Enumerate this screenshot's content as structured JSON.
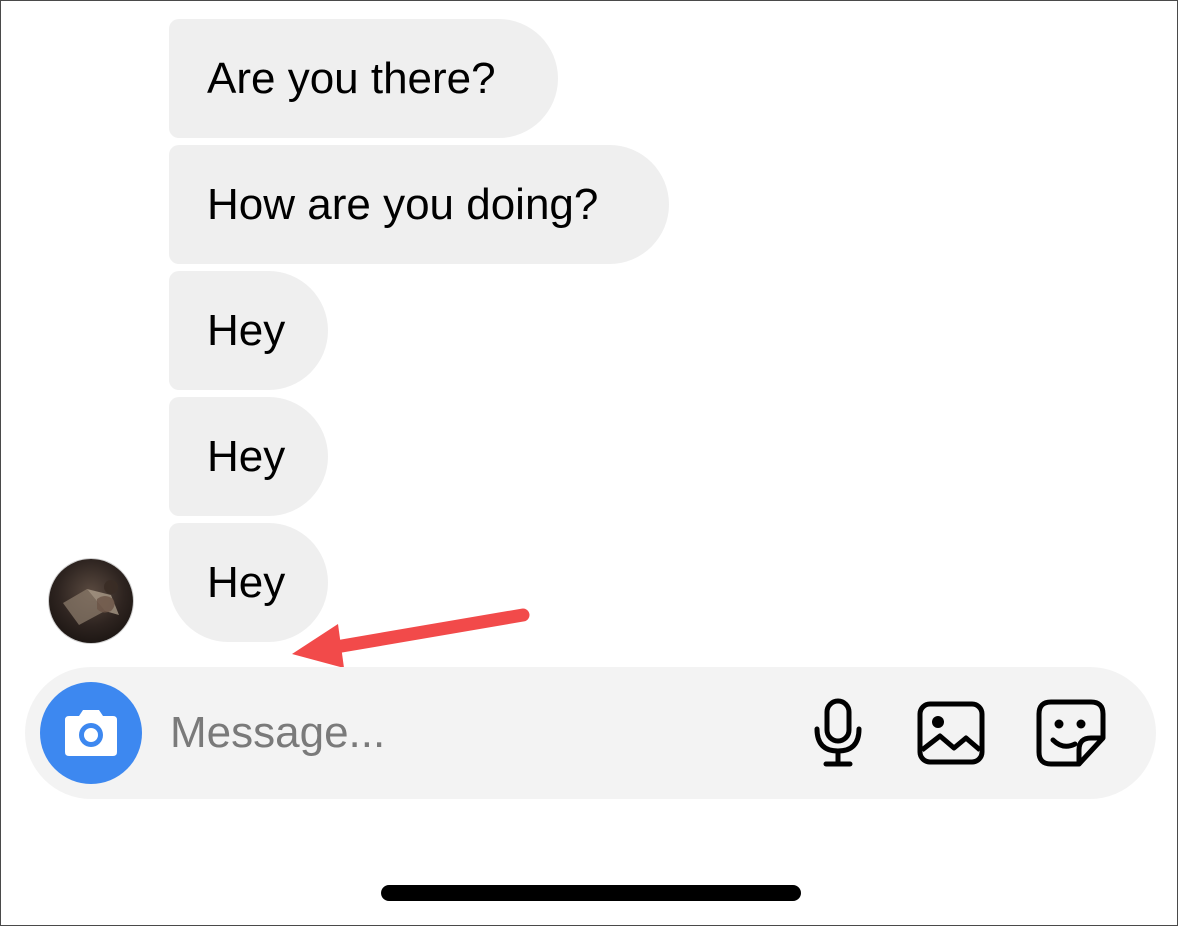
{
  "messages": [
    {
      "text": "Are you there?"
    },
    {
      "text": "How are you doing?"
    },
    {
      "text": "Hey"
    },
    {
      "text": "Hey"
    },
    {
      "text": "Hey"
    }
  ],
  "composer": {
    "placeholder": "Message...",
    "camera_icon": "camera-icon",
    "mic_icon": "microphone-icon",
    "gallery_icon": "image-icon",
    "sticker_icon": "sticker-icon"
  },
  "annotation": {
    "arrow_color": "#f24a4a"
  },
  "colors": {
    "bubble_bg": "#efefef",
    "composer_bg": "#f3f3f3",
    "camera_accent": "#3d88f0"
  }
}
